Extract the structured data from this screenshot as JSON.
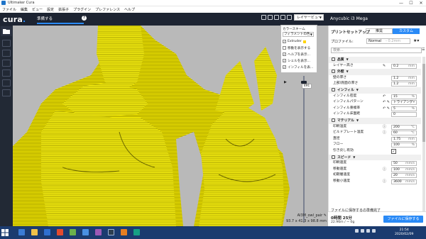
{
  "window": {
    "title": "Ultimaker Cura",
    "controls": [
      "—",
      "☐",
      "✕"
    ]
  },
  "menubar": [
    "ファイル",
    "編集",
    "ビュー",
    "設定",
    "拡張子",
    "プラグイン",
    "プレファレンス",
    "ヘルプ"
  ],
  "header": {
    "logo": "cura",
    "stage_tab": "準備する",
    "help_icon": "?",
    "view_select": "レイヤービュー"
  },
  "printer": {
    "name": "Anycubic i3 Mega"
  },
  "color_panel": {
    "title": "カラースキーム",
    "scheme": "フィラメントの色",
    "options": [
      {
        "label": "Extruder",
        "checked": true
      },
      {
        "label": "移動を表示する",
        "checked": false
      },
      {
        "label": "ヘルプを表示...",
        "checked": true
      },
      {
        "label": "シェルを表示...",
        "checked": true
      },
      {
        "label": "インフィルを表...",
        "checked": true
      }
    ],
    "swatch_color": "#ffd400"
  },
  "layer": {
    "value": "491"
  },
  "object": {
    "name": "AI3M_owl_pair",
    "dimensions": "93.7 x 41.3 x 98.8 mm"
  },
  "print_setup": {
    "title": "プリントセットアップ",
    "modes": [
      "推奨",
      "カスタム"
    ],
    "profile_label": "プロファイル:",
    "profile_value": "Normal",
    "profile_hint": "- 0.2mm",
    "search_placeholder": "検索..."
  },
  "settings": [
    {
      "type": "cat",
      "label": "品質"
    },
    {
      "type": "val",
      "label": "レイヤー高さ",
      "value": "0.2",
      "unit": "mm",
      "icon": "✎"
    },
    {
      "type": "cat",
      "label": "外壁"
    },
    {
      "type": "val",
      "label": "壁の厚さ",
      "value": "1.2",
      "unit": "mm"
    },
    {
      "type": "val",
      "label": "上部/底面の厚さ",
      "value": "1.2",
      "unit": "mm"
    },
    {
      "type": "cat",
      "label": "インフィル"
    },
    {
      "type": "val",
      "label": "インフィル密度",
      "value": "15",
      "unit": "%",
      "icon": "↶"
    },
    {
      "type": "val",
      "label": "インフィルパターン",
      "value": "トライアング",
      "unit": "▾",
      "icon": "↶ ✎"
    },
    {
      "type": "val",
      "label": "インフィル重複率",
      "value": "5",
      "unit": "%",
      "icon": "↶ ✎"
    },
    {
      "type": "val",
      "label": "インフィル床面距",
      "value": "0",
      "unit": ""
    },
    {
      "type": "cat",
      "label": "マテリアル"
    },
    {
      "type": "val",
      "label": "印刷温度",
      "value": "200",
      "unit": "°C",
      "icon": "ⓘ"
    },
    {
      "type": "val",
      "label": "ビルドプレート温度",
      "value": "60",
      "unit": "°C",
      "icon": "ⓘ"
    },
    {
      "type": "val",
      "label": "直径",
      "value": "1.75",
      "unit": "mm"
    },
    {
      "type": "val",
      "label": "フロー",
      "value": "100",
      "unit": "%"
    },
    {
      "type": "chk",
      "label": "引き戻し有効",
      "checked": true
    },
    {
      "type": "cat",
      "label": "スピード"
    },
    {
      "type": "val",
      "label": "印刷速度",
      "value": "50",
      "unit": "mm/s"
    },
    {
      "type": "val",
      "label": "移動速度",
      "value": "100",
      "unit": "mm/s",
      "icon": "ⓘ"
    },
    {
      "type": "val",
      "label": "初期層速度",
      "value": "20",
      "unit": "mm/s"
    },
    {
      "type": "val",
      "label": "移動小速度",
      "value": "3600",
      "unit": "mm/s",
      "icon": "ⓘ"
    }
  ],
  "action": {
    "ready_text": "ファイルに保存するの準備完了",
    "time": "0時間 25分",
    "material": "22.96m / ~ 0g",
    "save_button": "ファイルに保存する"
  },
  "taskbar": {
    "time": "21:54",
    "date": "2020/02/09"
  }
}
